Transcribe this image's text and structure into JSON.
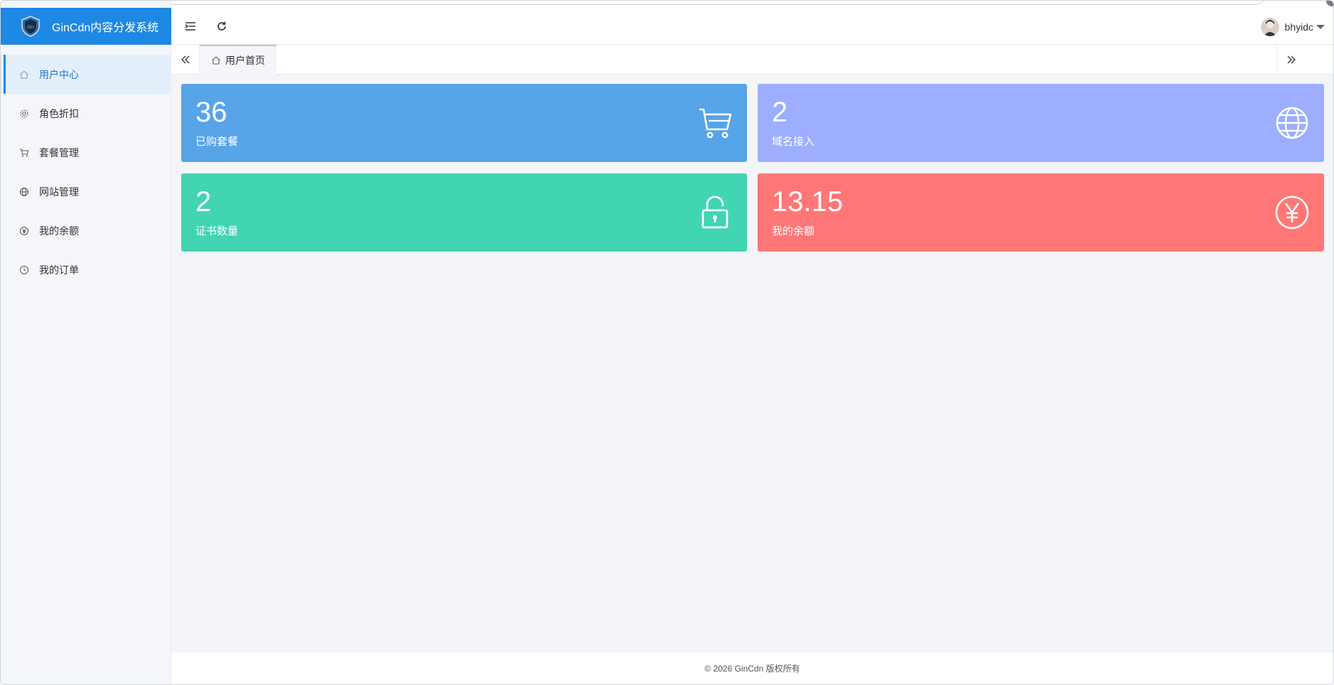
{
  "app": {
    "title": "GinCdn内容分发系统"
  },
  "sidebar": {
    "items": [
      {
        "label": "用户中心",
        "icon": "home-icon",
        "active": true
      },
      {
        "label": "角色折扣",
        "icon": "gear-icon",
        "active": false
      },
      {
        "label": "套餐管理",
        "icon": "cart-icon",
        "active": false
      },
      {
        "label": "网站管理",
        "icon": "globe-icon",
        "active": false
      },
      {
        "label": "我的余额",
        "icon": "yen-circle-icon",
        "active": false
      },
      {
        "label": "我的订单",
        "icon": "clock-icon",
        "active": false
      }
    ]
  },
  "header": {
    "username": "bhyidc"
  },
  "tabs": {
    "home_label": "用户首页"
  },
  "stats": [
    {
      "value": "36",
      "label": "已购套餐",
      "icon": "cart-icon",
      "color": "#57a4e9"
    },
    {
      "value": "2",
      "label": "域名接入",
      "icon": "globe-icon",
      "color": "#9caefd"
    },
    {
      "value": "2",
      "label": "证书数量",
      "icon": "unlock-icon",
      "color": "#41d5b2"
    },
    {
      "value": "13.15",
      "label": "我的余额",
      "icon": "yen-circle-icon",
      "color": "#fe7776"
    }
  ],
  "footer": {
    "text": "© 2026 GinCdn 版权所有"
  },
  "colors": {
    "brand": "#1e88e5",
    "sidebar_bg": "#f4f6fa",
    "active_item_bg": "#e3effb"
  }
}
